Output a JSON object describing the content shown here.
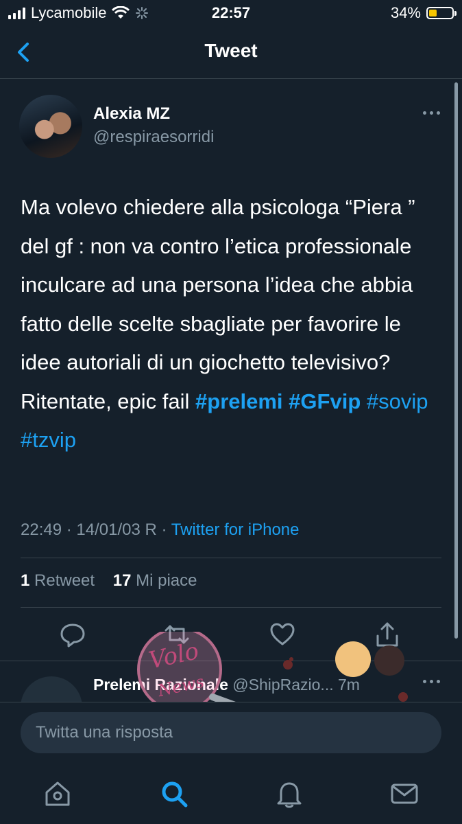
{
  "status_bar": {
    "carrier": "Lycamobile",
    "time": "22:57",
    "battery": "34%",
    "battery_level": 0.34
  },
  "nav": {
    "title": "Tweet",
    "back_icon": "chevron-left-icon"
  },
  "tweet": {
    "author_name": "Alexia MZ",
    "author_handle": "@respiraesorridi",
    "text_plain": "Ma volevo chiedere alla psicologa “Piera ” del gf : non va contro l’etica professionale inculcare ad una persona l’idea che abbia fatto delle scelte sbagliate per favorire le idee autoriali di un giochetto televisivo? Ritentate, epic fail ",
    "hashtags": [
      "#prelemi",
      "#GFvip",
      "#sovip",
      "#tzvip"
    ],
    "time": "22:49",
    "date": "14/01/03 R",
    "separator": "·",
    "source": "Twitter for iPhone",
    "retweets_count": "1",
    "retweets_label": "Retweet",
    "likes_count": "17",
    "likes_label": "Mi piace",
    "actions": [
      "reply-icon",
      "retweet-icon",
      "like-icon",
      "share-icon"
    ]
  },
  "reply_preview": {
    "name": "Prelemi Razionale",
    "handle": "@ShipRazio...",
    "age": "7m"
  },
  "watermark": {
    "text": "Vololo News"
  },
  "compose": {
    "placeholder": "Twitta una risposta"
  },
  "tabbar": {
    "items": [
      "home-icon",
      "search-icon",
      "notifications-icon",
      "messages-icon"
    ],
    "active": "search-icon"
  },
  "colors": {
    "background": "#15202b",
    "accent": "#1da1f2",
    "secondary_text": "#8899a6",
    "divider": "#38444d",
    "battery": "#f7c600"
  }
}
